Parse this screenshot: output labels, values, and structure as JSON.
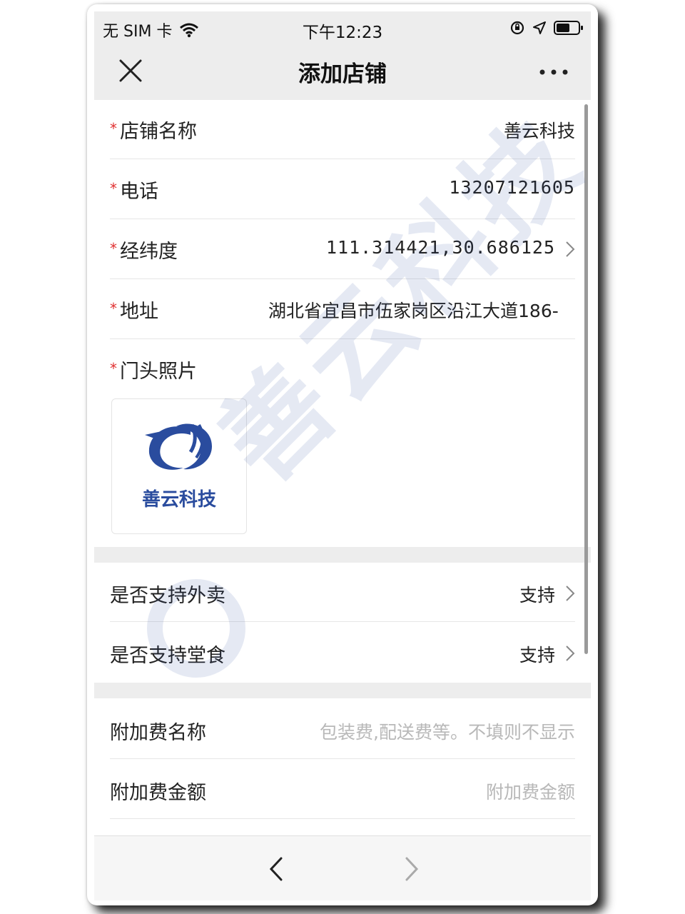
{
  "status_bar": {
    "carrier": "无 SIM 卡",
    "time": "下午12:23",
    "icons": [
      "wifi-icon",
      "rotation-lock-icon",
      "location-icon",
      "battery-icon"
    ]
  },
  "nav": {
    "title": "添加店铺",
    "close_icon": "close-icon",
    "more_icon": "more-icon"
  },
  "form": {
    "required_mark": "*",
    "shop_name": {
      "label": "店铺名称",
      "value": "善云科技"
    },
    "phone": {
      "label": "电话",
      "value": "13207121605"
    },
    "coords": {
      "label": "经纬度",
      "value": "111.314421,30.686125"
    },
    "address": {
      "label": "地址",
      "value": "湖北省宜昌市伍家岗区沿江大道186-"
    },
    "photo": {
      "label": "门头照片",
      "logo_text": "善云科技"
    }
  },
  "options": {
    "takeout": {
      "label": "是否支持外卖",
      "value": "支持"
    },
    "dine_in": {
      "label": "是否支持堂食",
      "value": "支持"
    }
  },
  "fees": {
    "fee_name": {
      "label": "附加费名称",
      "placeholder": "包装费,配送费等。不填则不显示"
    },
    "fee_amount": {
      "label": "附加费金额",
      "placeholder": "附加费金额"
    }
  },
  "watermark": {
    "text": "善云科技"
  },
  "colors": {
    "accent": "#2a4c9e",
    "required": "#e03030",
    "topbar_bg": "#ededed"
  }
}
